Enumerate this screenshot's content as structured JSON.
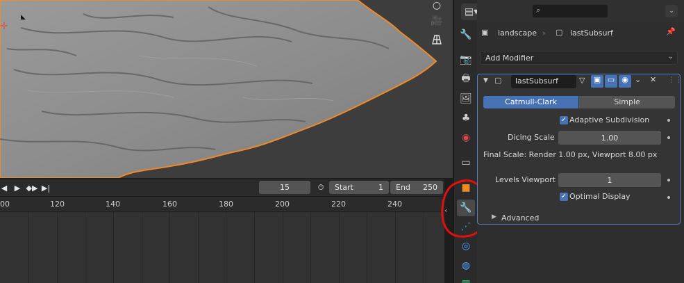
{
  "timeline": {
    "current_frame": "15",
    "start_label": "Start",
    "start_value": "1",
    "end_label": "End",
    "end_value": "250",
    "ruler_ticks": [
      "00",
      "120",
      "140",
      "160",
      "180",
      "200",
      "220",
      "240"
    ]
  },
  "properties": {
    "breadcrumb_object": "landscape",
    "breadcrumb_modifier": "lastSubsurf",
    "add_modifier_label": "Add Modifier",
    "modifier_name": "lastSubsurf",
    "tabs": {
      "catmull": "Catmull-Clark",
      "simple": "Simple"
    },
    "adaptive_subdivision_label": "Adaptive Subdivision",
    "dicing_scale_label": "Dicing Scale",
    "dicing_scale_value": "1.00",
    "final_scale_text": "Final Scale: Render 1.00 px, Viewport 8.00 px",
    "levels_viewport_label": "Levels Viewport",
    "levels_viewport_value": "1",
    "optimal_display_label": "Optimal Display",
    "advanced_label": "Advanced"
  },
  "colors": {
    "accent": "#4772b3",
    "selection_outline": "#f08a24",
    "annotation_red": "#e01010"
  }
}
